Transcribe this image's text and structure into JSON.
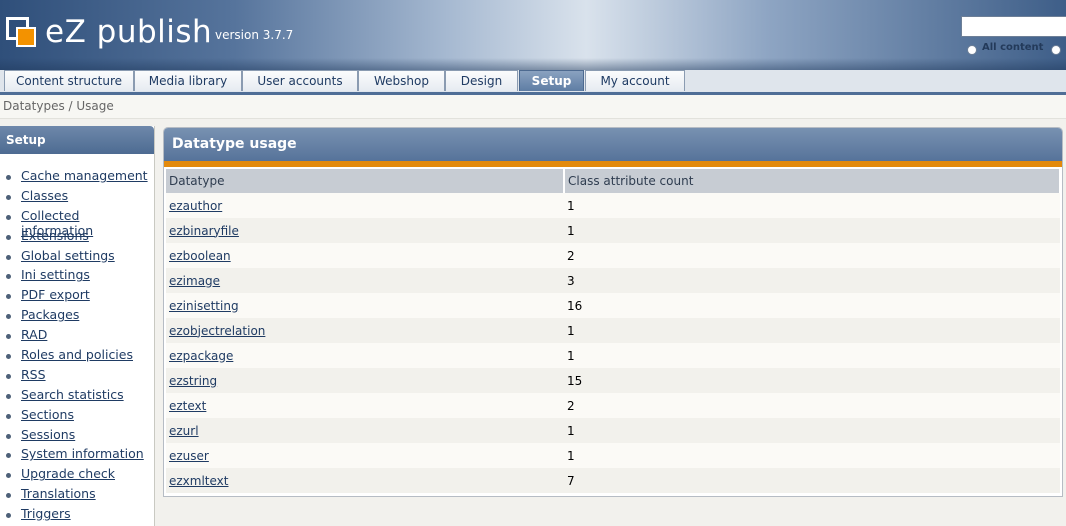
{
  "header": {
    "logo_text": "eZ publish",
    "version": "version 3.7.7",
    "search": {
      "value": "",
      "placeholder": ""
    },
    "radio_all_label": "All content"
  },
  "tabs": [
    {
      "label": "Content structure",
      "active": false
    },
    {
      "label": "Media library",
      "active": false
    },
    {
      "label": "User accounts",
      "active": false
    },
    {
      "label": "Webshop",
      "active": false
    },
    {
      "label": "Design",
      "active": false
    },
    {
      "label": "Setup",
      "active": true
    },
    {
      "label": "My account",
      "active": false
    }
  ],
  "breadcrumb": "Datatypes / Usage",
  "leftmenu": {
    "title": "Setup",
    "items": [
      "Cache management",
      "Classes",
      "Collected information",
      "Extensions",
      "Global settings",
      "Ini settings",
      "PDF export",
      "Packages",
      "RAD",
      "Roles and policies",
      "RSS",
      "Search statistics",
      "Sections",
      "Sessions",
      "System information",
      "Upgrade check",
      "Translations",
      "Triggers"
    ]
  },
  "panel": {
    "title": "Datatype usage",
    "columns": [
      "Datatype",
      "Class attribute count"
    ],
    "rows": [
      {
        "datatype": "ezauthor",
        "count": "1"
      },
      {
        "datatype": "ezbinaryfile",
        "count": "1"
      },
      {
        "datatype": "ezboolean",
        "count": "2"
      },
      {
        "datatype": "ezimage",
        "count": "3"
      },
      {
        "datatype": "ezinisetting",
        "count": "16"
      },
      {
        "datatype": "ezobjectrelation",
        "count": "1"
      },
      {
        "datatype": "ezpackage",
        "count": "1"
      },
      {
        "datatype": "ezstring",
        "count": "15"
      },
      {
        "datatype": "eztext",
        "count": "2"
      },
      {
        "datatype": "ezurl",
        "count": "1"
      },
      {
        "datatype": "ezuser",
        "count": "1"
      },
      {
        "datatype": "ezxmltext",
        "count": "7"
      }
    ]
  },
  "colors": {
    "accent": "#e38a0c",
    "header_blue": "#56739a",
    "link": "#1f3b63"
  }
}
